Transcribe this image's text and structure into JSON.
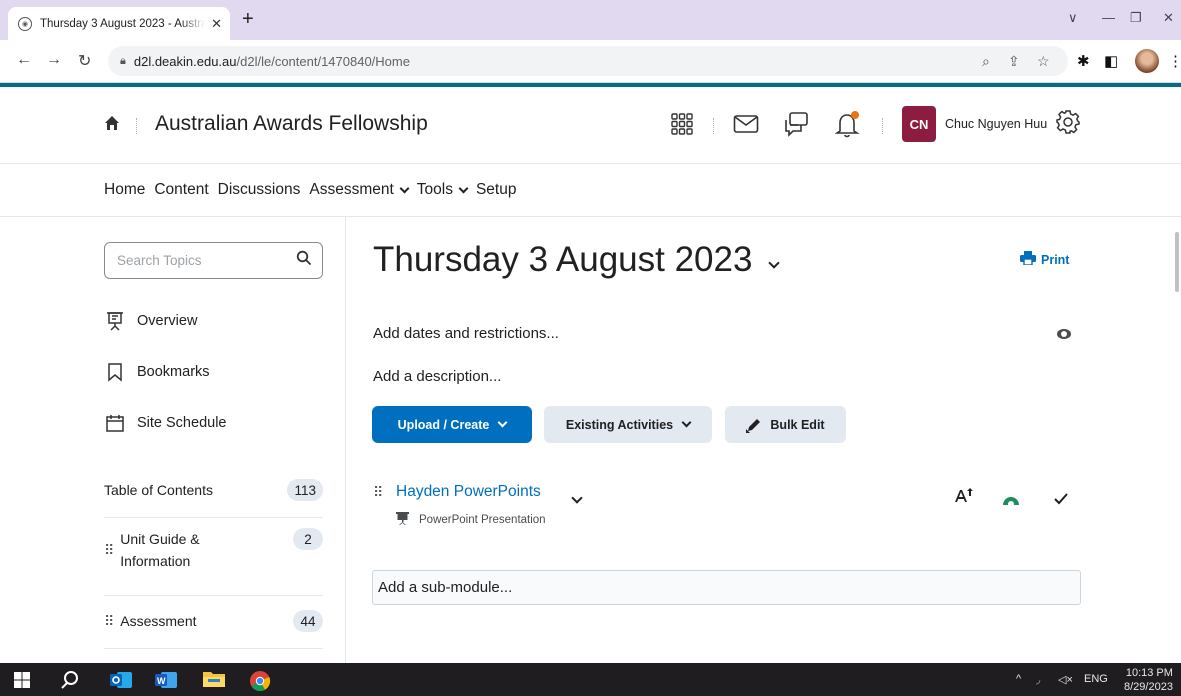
{
  "browser": {
    "tab_title": "Thursday 3 August 2023 - Australian Awards Fellowship",
    "tab_close": "✕",
    "new_tab": "+",
    "url_host": "d2l.deakin.edu.au",
    "url_path": "/d2l/le/content/1470840/Home"
  },
  "header": {
    "course_title": "Australian Awards Fellowship",
    "avatar_initials": "CN",
    "user_name": "Chuc Nguyen Huu",
    "avatar_color": "#8c1d40"
  },
  "nav": {
    "items": [
      {
        "label": "Home"
      },
      {
        "label": "Content"
      },
      {
        "label": "Discussions"
      },
      {
        "label": "Assessment"
      },
      {
        "label": "Tools"
      },
      {
        "label": "Setup"
      }
    ]
  },
  "sidebar": {
    "search_placeholder": "Search Topics",
    "items": [
      {
        "label": "Overview",
        "icon": "overview-icon"
      },
      {
        "label": "Bookmarks",
        "icon": "bookmark-icon"
      },
      {
        "label": "Site Schedule",
        "icon": "calendar-icon"
      }
    ],
    "toc": {
      "label": "Table of Contents",
      "count": "113"
    },
    "modules": [
      {
        "label": "Unit Guide & Information",
        "count": "2"
      },
      {
        "label": "Assessment",
        "count": "44"
      }
    ]
  },
  "main": {
    "title": "Thursday 3 August 2023",
    "print_label": "Print",
    "add_dates": "Add dates and restrictions...",
    "add_description": "Add a description...",
    "buttons": {
      "upload_create": "Upload / Create",
      "existing_activities": "Existing Activities",
      "bulk_edit": "Bulk Edit"
    },
    "topic": {
      "title": "Hayden PowerPoints",
      "type": "PowerPoint Presentation"
    },
    "add_submodule": "Add a sub-module..."
  },
  "taskbar": {
    "language": "ENG",
    "time": "10:13 PM",
    "date": "8/29/2023"
  },
  "colors": {
    "primary": "#006fbf",
    "accent_bar": "#006f82",
    "tabstrip": "#e1d9f0"
  }
}
